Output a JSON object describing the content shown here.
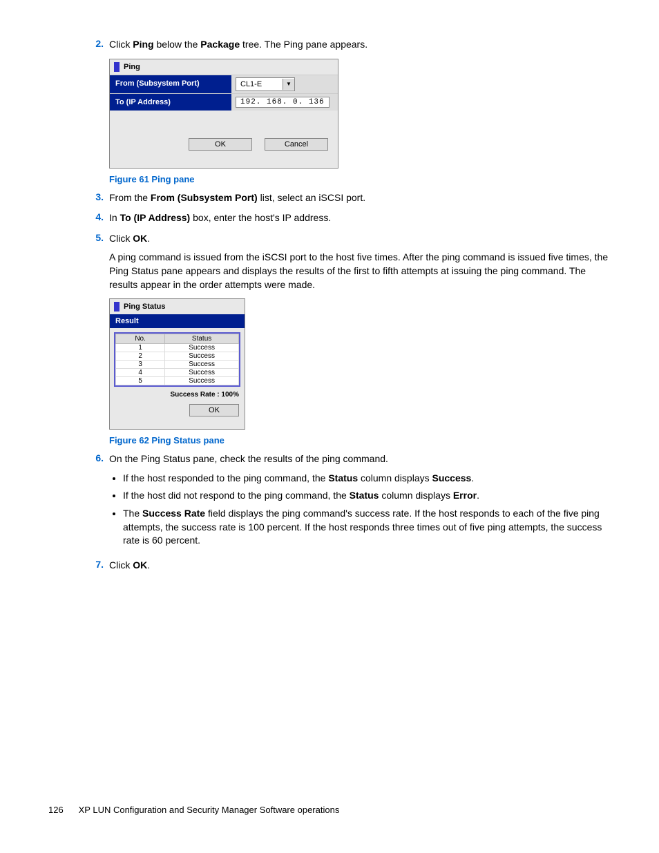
{
  "footer": {
    "page_number": "126",
    "section": "XP LUN Configuration and Security Manager Software operations"
  },
  "steps": {
    "s2": {
      "num": "2.",
      "t1": "Click ",
      "b1": "Ping",
      "t2": " below the ",
      "b2": "Package",
      "t3": " tree. The Ping pane appears."
    },
    "s3": {
      "num": "3.",
      "t1": "From the ",
      "b1": "From (Subsystem Port)",
      "t2": " list, select an iSCSI port."
    },
    "s4": {
      "num": "4.",
      "t1": "In ",
      "b1": "To (IP Address)",
      "t2": " box, enter the host's IP address."
    },
    "s5": {
      "num": "5.",
      "t1": "Click ",
      "b1": "OK",
      "t2": ".",
      "para": "A ping command is issued from the iSCSI port to the host five times. After the ping command is issued five times, the Ping Status pane appears and displays the results of the first to fifth attempts at issuing the ping command. The results appear in the order attempts were made."
    },
    "s6": {
      "num": "6.",
      "text": "On the Ping Status pane, check the results of the ping command.",
      "b1": {
        "t1": "If the host responded to the ping command, the ",
        "b1": "Status",
        "t2": " column displays ",
        "b2": "Success",
        "t3": "."
      },
      "b2": {
        "t1": "If the host did not respond to the ping command, the ",
        "b1": "Status",
        "t2": " column displays ",
        "b2": "Error",
        "t3": "."
      },
      "b3": {
        "t1": "The ",
        "b1": "Success Rate",
        "t2": " field displays the ping command's success rate. If the host responds to each of the five ping attempts, the success rate is 100 percent. If the host responds three times out of five ping attempts, the success rate is 60 percent."
      }
    },
    "s7": {
      "num": "7.",
      "t1": "Click ",
      "b1": "OK",
      "t2": "."
    }
  },
  "fig61": {
    "caption": "Figure 61 Ping pane",
    "title": "Ping",
    "from_label": "From (Subsystem Port)",
    "to_label": "To (IP Address)",
    "from_value": "CL1-E",
    "to_value": "192. 168.   0. 136",
    "ok": "OK",
    "cancel": "Cancel"
  },
  "fig62": {
    "caption": "Figure 62 Ping Status pane",
    "title": "Ping Status",
    "result": "Result",
    "col_no": "No.",
    "col_status": "Status",
    "rows": [
      {
        "no": "1",
        "status": "Success"
      },
      {
        "no": "2",
        "status": "Success"
      },
      {
        "no": "3",
        "status": "Success"
      },
      {
        "no": "4",
        "status": "Success"
      },
      {
        "no": "5",
        "status": "Success"
      }
    ],
    "rate": "Success Rate : 100%",
    "ok": "OK"
  }
}
